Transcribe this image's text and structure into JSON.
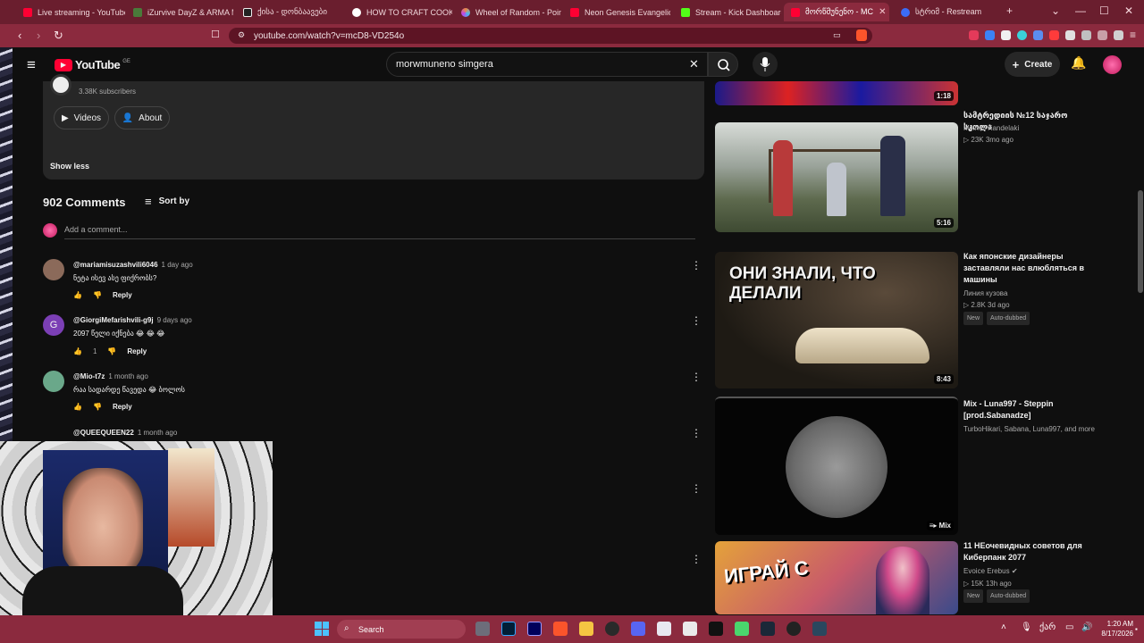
{
  "browser": {
    "tabs": [
      {
        "label": "Live streaming - YouTube",
        "color": "#ff0033"
      },
      {
        "label": "iZurvive DayZ & ARMA M",
        "color": "#4a7a3a"
      },
      {
        "label": "ქისა - დონბაავები",
        "color": "#f1f1f1"
      },
      {
        "label": "HOW TO CRAFT COOKIN",
        "color": "#e8e8e8"
      },
      {
        "label": "Wheel of Random - Point",
        "color": "#d94fbf"
      },
      {
        "label": "Neon Genesis Evangelion",
        "color": "#ff0033"
      },
      {
        "label": "Stream - Kick Dashboard",
        "color": "#53fc18"
      },
      {
        "label": "მორწმუნენო - MC",
        "color": "#ff0033"
      },
      {
        "label": "სტრიმ - Restream",
        "color": "#3b6cf6"
      }
    ],
    "new_tab": "+",
    "url": "youtube.com/watch?v=mcD8-VD254o"
  },
  "youtube": {
    "logo": "YouTube",
    "region": "GE",
    "search_value": "morwmuneno simgera",
    "create_label": "Create",
    "channel": {
      "subscribers": "3.38K subscribers",
      "videos_label": "Videos",
      "about_label": "About",
      "show_less": "Show less"
    },
    "comments_count": "902 Comments",
    "sort_label": "Sort by",
    "add_comment_placeholder": "Add a comment...",
    "reply_label": "Reply",
    "comments": [
      {
        "user": "@mariamisuzashvili6046",
        "time": "1 day ago",
        "text": "ნეტა ისევ ასე ფიქრობს?",
        "likes": ""
      },
      {
        "user": "@GiorgiMefarishvili-g9j",
        "time": "9 days ago",
        "text": "2097 წელი იქნება 😂 😂 😂",
        "likes": "1"
      },
      {
        "user": "@Mio-t7z",
        "time": "1 month ago",
        "text": "რაა სადარდე წავედა 😂 ბოლოს",
        "likes": ""
      },
      {
        "user": "@QUEEQUEEN22",
        "time": "1 month ago",
        "text": "",
        "likes": ""
      }
    ],
    "related": [
      {
        "title": "",
        "channel": "",
        "meta": "",
        "duration": "1:18"
      },
      {
        "title": "სამტრედიის №12 საჯარო სკოლა",
        "channel": "Mikheil Kandelaki",
        "meta": "23K  3mo ago",
        "duration": "5:16"
      },
      {
        "title": "Как японские дизайнеры заставляли нас влюбляться в машины",
        "channel": "Линия кузова",
        "meta": "2.8K  3d ago",
        "duration": "8:43",
        "badges": [
          "New",
          "Auto-dubbed"
        ],
        "thumb_text": "ОНИ ЗНАЛИ, ЧТО ДЕЛАЛИ"
      },
      {
        "title": "Mix - Luna997 - Steppin [prod.Sabanadze]",
        "channel": "TurboHikari, Sabana, Luna997, and more",
        "meta": "",
        "duration": "Mix"
      },
      {
        "title": "11 НЕочевидных советов для Киберпанк 2077",
        "channel": "Evoice Erebus",
        "meta": "15K  13h ago",
        "duration": "",
        "badges": [
          "New",
          "Auto-dubbed"
        ],
        "thumb_text": "ИГРАЙ С"
      }
    ]
  },
  "taskbar": {
    "search_label": "Search",
    "lang": "ქარ",
    "time": "1:20 AM",
    "date": "8/17/2026"
  }
}
